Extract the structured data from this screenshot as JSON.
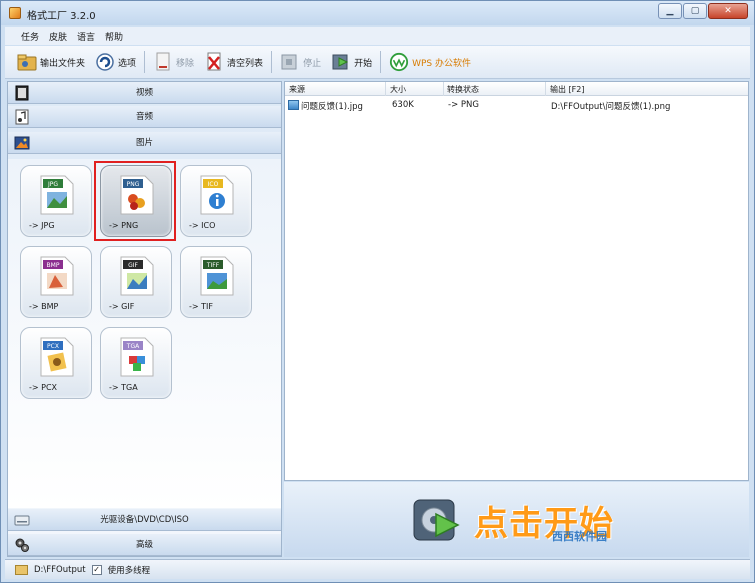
{
  "window": {
    "title": "格式工厂 3.2.0"
  },
  "menubar": [
    "任务",
    "皮肤",
    "语言",
    "帮助"
  ],
  "toolbar": {
    "output_folder": "输出文件夹",
    "options": "选项",
    "remove": "移除",
    "clear_list": "清空列表",
    "stop": "停止",
    "start": "开始",
    "wps": "WPS 办公软件"
  },
  "categories": {
    "video": "视频",
    "audio": "音频",
    "picture": "图片",
    "optical": "光驱设备\\DVD\\CD\\ISO",
    "advanced": "高级"
  },
  "tiles": [
    {
      "label": "-> JPG",
      "badge": "JPG",
      "color": "#2f7d3a"
    },
    {
      "label": "-> PNG",
      "badge": "PNG",
      "color": "#2f5f8f"
    },
    {
      "label": "-> ICO",
      "badge": "ICO",
      "color": "#e8b820"
    },
    {
      "label": "-> BMP",
      "badge": "BMP",
      "color": "#8b2f8f"
    },
    {
      "label": "-> GIF",
      "badge": "GIF",
      "color": "#2b2b2b"
    },
    {
      "label": "-> TIF",
      "badge": "TIFF",
      "color": "#2b5c2b"
    },
    {
      "label": "-> PCX",
      "badge": "PCX",
      "color": "#2f6fbf"
    },
    {
      "label": "-> TGA",
      "badge": "TGA",
      "color": "#9a84c7"
    }
  ],
  "table": {
    "headers": [
      "来源",
      "大小",
      "转换状态",
      "输出 [F2]"
    ],
    "rows": [
      {
        "source": "问题反馈(1).jpg",
        "size": "630K",
        "status": "-> PNG",
        "output": "D:\\FFOutput\\问题反馈(1).png"
      }
    ]
  },
  "start_area": {
    "label": "点击开始",
    "watermark": "西西软件园"
  },
  "statusbar": {
    "output_path": "D:\\FFOutput",
    "multithread": "使用多线程",
    "multithread_checked": "✓"
  }
}
